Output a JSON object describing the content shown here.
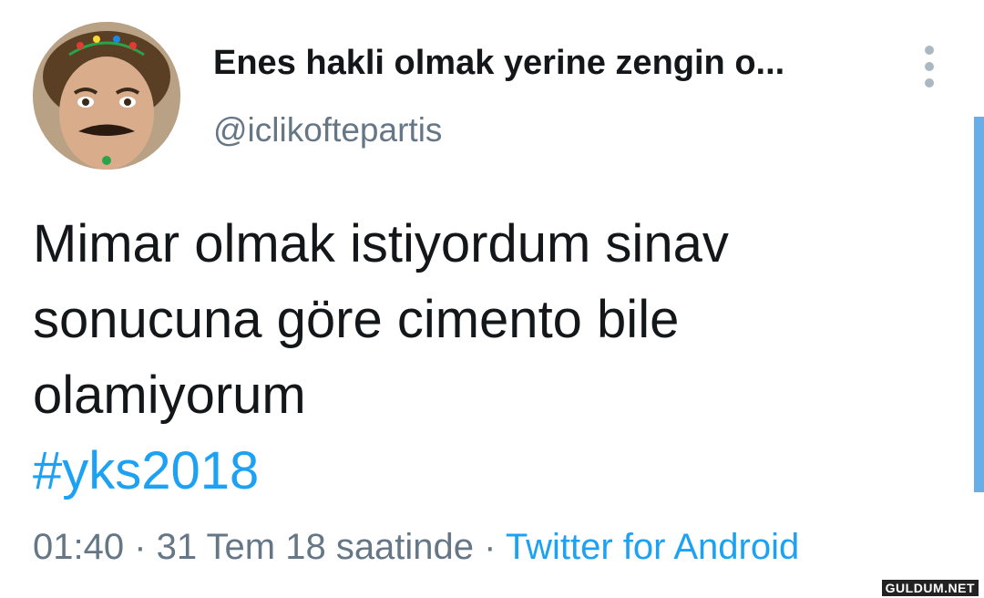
{
  "tweet": {
    "author_name": "Enes hakli olmak yerine zengin o...",
    "author_handle": "@iclikoftepartis",
    "text_lines": [
      "Mimar olmak istiyordum sinav",
      "sonucuna göre cimento bile",
      "olamiyorum"
    ],
    "hashtag": "#yks2018",
    "timestamp": "01:40 · 31 Tem 18 saatinde",
    "separator": " · ",
    "source": "Twitter for Android"
  },
  "icons": {
    "menu": "more-vertical-icon",
    "avatar": "profile-avatar"
  },
  "colors": {
    "text": "#14171a",
    "secondary": "#657786",
    "link": "#1da1f2",
    "menu_dots": "#aab8c2",
    "scrollbar": "#6aaee8"
  },
  "watermark": "GULDUM.NET"
}
